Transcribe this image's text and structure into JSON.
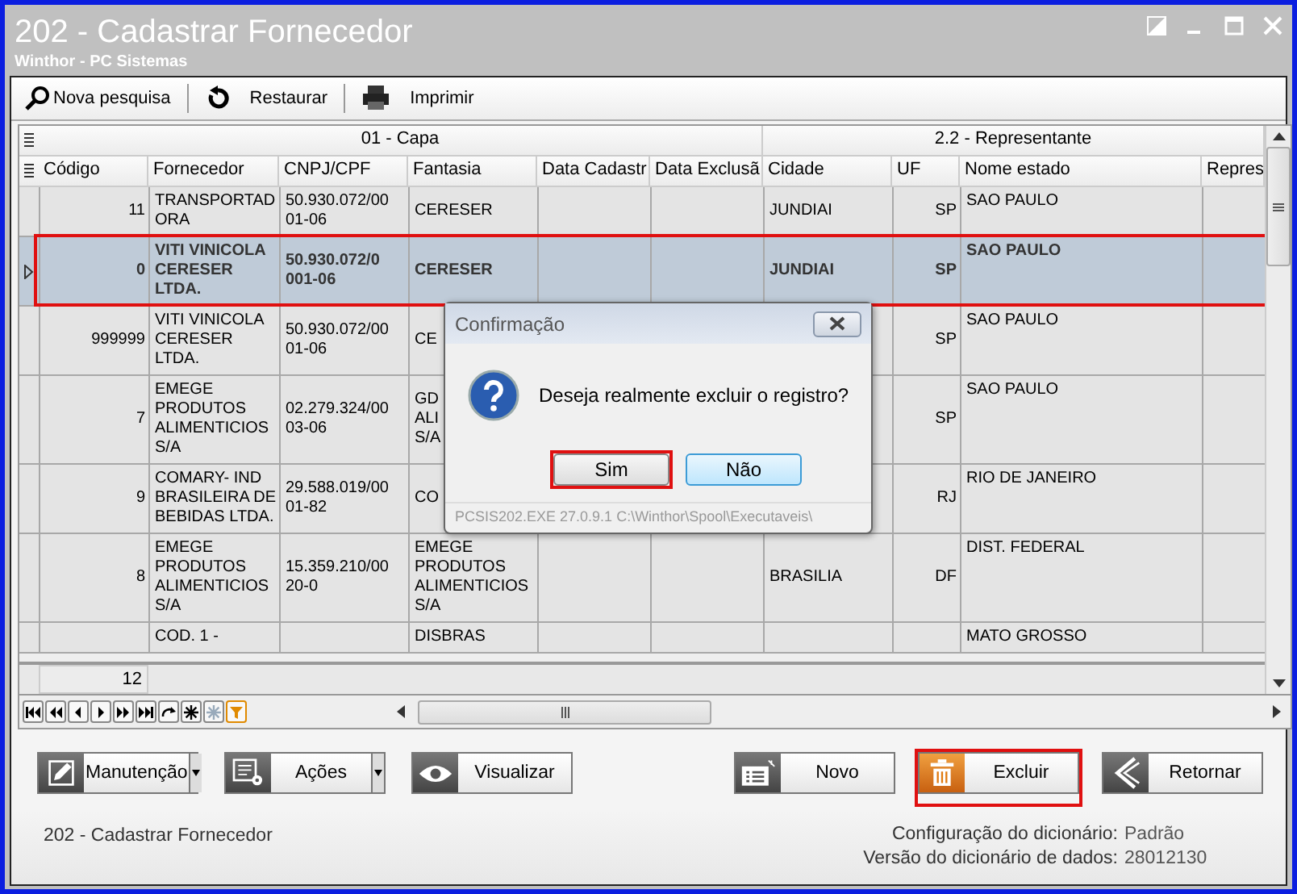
{
  "window": {
    "title": "202 - Cadastrar  Fornecedor",
    "subtitle": "Winthor - PC Sistemas"
  },
  "toolbar": [
    {
      "kind": "search",
      "label": "Nova pesquisa"
    },
    {
      "kind": "restore",
      "label": "Restaurar"
    },
    {
      "kind": "print",
      "label": "Imprimir"
    }
  ],
  "table": {
    "column_groups": [
      {
        "label": "01 - Capa"
      },
      {
        "label": "2.2 - Representante"
      }
    ],
    "columns": [
      "Código",
      "Fornecedor",
      "CNPJ/CPF",
      "Fantasia",
      "Data Cadastr",
      "Data Exclusã",
      "Cidade",
      "UF",
      "Nome estado",
      "Repres"
    ],
    "rows": [
      {
        "selected": false,
        "highlighted": false,
        "cells": [
          "11",
          "TRANSPORTAD\nORA",
          "50.930.072/00\n01-06",
          "CERESER",
          "",
          "",
          "JUNDIAI",
          "SP",
          "SAO PAULO",
          ""
        ]
      },
      {
        "selected": true,
        "highlighted": true,
        "cells": [
          "0",
          "VITI VINICOLA\nCERESER\nLTDA.",
          "50.930.072/0\n001-06",
          "CERESER",
          "",
          "",
          "JUNDIAI",
          "SP",
          "SAO PAULO",
          ""
        ]
      },
      {
        "selected": false,
        "highlighted": false,
        "cells": [
          "999999",
          "VITI VINICOLA\nCERESER\nLTDA.",
          "50.930.072/00\n01-06",
          "CE",
          "",
          "",
          "",
          "SP",
          "SAO PAULO",
          ""
        ]
      },
      {
        "selected": false,
        "highlighted": false,
        "cells": [
          "7",
          "EMEGE\nPRODUTOS\nALIMENTICIOS\nS/A",
          "02.279.324/00\n03-06",
          "GD\nALI\nS/A",
          "",
          "",
          "",
          "SP",
          "SAO PAULO",
          ""
        ]
      },
      {
        "selected": false,
        "highlighted": false,
        "cells": [
          "9",
          "COMARY- IND\nBRASILEIRA DE\nBEBIDAS LTDA.",
          "29.588.019/00\n01-82",
          "CO",
          "",
          "",
          "",
          "RJ",
          "RIO DE JANEIRO",
          ""
        ]
      },
      {
        "selected": false,
        "highlighted": false,
        "cells": [
          "8",
          "EMEGE\nPRODUTOS\nALIMENTICIOS\nS/A",
          "15.359.210/00\n20-0",
          "EMEGE\nPRODUTOS\nALIMENTICIOS\nS/A",
          "",
          "",
          "BRASILIA",
          "DF",
          "DIST. FEDERAL",
          ""
        ]
      },
      {
        "selected": false,
        "highlighted": false,
        "cells": [
          "",
          "COD. 1 -",
          "",
          "DISBRAS",
          "",
          "",
          "",
          "",
          "MATO GROSSO",
          ""
        ]
      }
    ],
    "footer": [
      "12"
    ]
  },
  "dialog": {
    "title": "Confirmação",
    "message": "Deseja realmente excluir o registro?",
    "buttons": [
      {
        "label": "Sim",
        "highlighted": true,
        "focused": false
      },
      {
        "label": "Não",
        "highlighted": false,
        "focused": true
      }
    ],
    "footer": "PCSIS202.EXE 27.0.9.1 C:\\Winthor\\Spool\\Executaveis\\"
  },
  "actions": {
    "left": [
      {
        "kind": "maintenance",
        "label": "Manutenção",
        "dropdown": true,
        "highlighted": false
      },
      {
        "kind": "actions",
        "label": "Ações",
        "dropdown": true,
        "highlighted": false
      },
      {
        "kind": "view",
        "label": "Visualizar",
        "dropdown": false,
        "highlighted": false
      }
    ],
    "right": [
      {
        "kind": "new",
        "label": "Novo",
        "dropdown": false,
        "highlighted": false
      },
      {
        "kind": "delete",
        "label": "Excluir",
        "dropdown": false,
        "highlighted": true
      },
      {
        "kind": "return",
        "label": "Retornar",
        "dropdown": false,
        "highlighted": false
      }
    ]
  },
  "status_bar": {
    "screen": "202 - Cadastrar  Fornecedor",
    "info": [
      {
        "label": "Configuração do dicionário:",
        "value": "Padrão"
      },
      {
        "label": "Versão do dicionário de dados:",
        "value": "28012130"
      }
    ]
  }
}
